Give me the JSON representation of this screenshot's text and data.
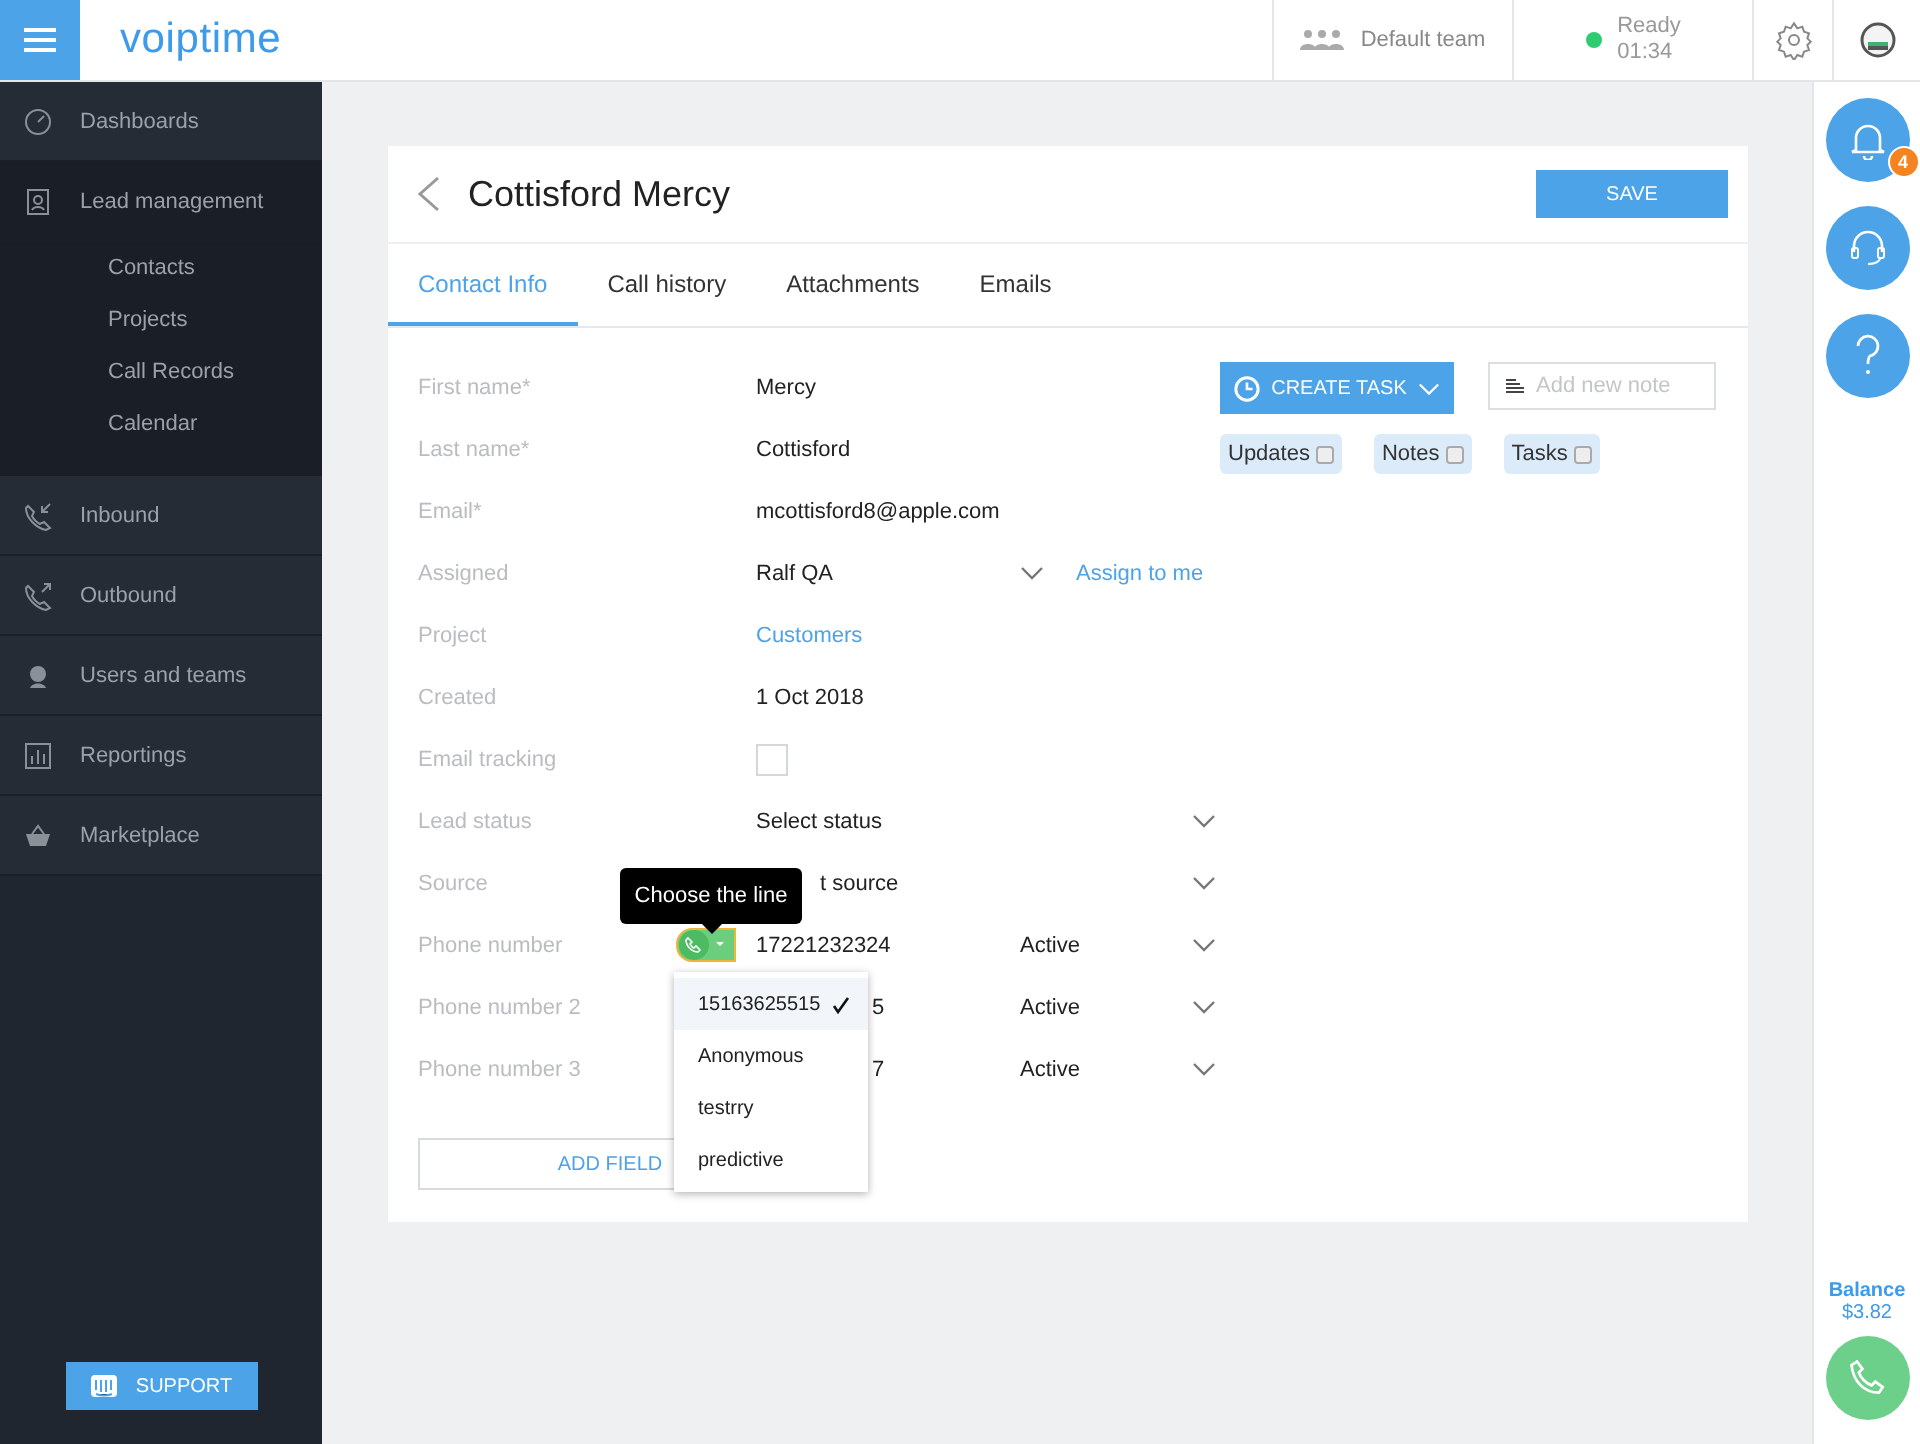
{
  "topbar": {
    "logo": "voiptime",
    "team": "Default team",
    "status": {
      "label": "Ready",
      "time": "01:34"
    }
  },
  "sidebar": {
    "items": [
      {
        "label": "Dashboards",
        "expanded": false
      },
      {
        "label": "Lead management",
        "expanded": true,
        "children": [
          {
            "label": "Contacts"
          },
          {
            "label": "Projects"
          },
          {
            "label": "Call Records"
          },
          {
            "label": "Calendar"
          }
        ]
      },
      {
        "label": "Inbound",
        "expanded": false
      },
      {
        "label": "Outbound",
        "expanded": false
      },
      {
        "label": "Users and teams",
        "expanded": false
      },
      {
        "label": "Reportings",
        "expanded": false
      },
      {
        "label": "Marketplace",
        "expanded": false
      }
    ],
    "support": "SUPPORT"
  },
  "contact": {
    "title": "Cottisford Mercy",
    "save": "SAVE",
    "tabs": [
      {
        "label": "Contact Info",
        "selected": true
      },
      {
        "label": "Call history",
        "selected": false
      },
      {
        "label": "Attachments",
        "selected": false
      },
      {
        "label": "Emails",
        "selected": false
      }
    ],
    "fields": [
      {
        "kind": "text",
        "label": "First name*",
        "value": "Mercy"
      },
      {
        "kind": "text",
        "label": "Last name*",
        "value": "Cottisford"
      },
      {
        "kind": "text",
        "label": "Email*",
        "value": "mcottisford8@apple.com"
      },
      {
        "kind": "assign",
        "label": "Assigned",
        "value": "Ralf QA",
        "action": "Assign to me"
      },
      {
        "kind": "link",
        "label": "Project",
        "value": "Customers"
      },
      {
        "kind": "text",
        "label": "Created",
        "value": "1 Oct 2018"
      },
      {
        "kind": "checkbox",
        "label": "Email tracking",
        "checked": false
      },
      {
        "kind": "select",
        "label": "Lead status",
        "value": "Select status"
      },
      {
        "kind": "select",
        "label": "Source",
        "value": "t source"
      },
      {
        "kind": "phone",
        "label": "Phone number",
        "value": "17221232324",
        "status": "Active",
        "line_button": true
      },
      {
        "kind": "phone",
        "label": "Phone number 2",
        "value": "5",
        "status": "Active"
      },
      {
        "kind": "phone",
        "label": "Phone number 3",
        "value": "7",
        "status": "Active"
      }
    ],
    "add_field": "ADD FIELD",
    "create_task": "CREATE TASK",
    "note": {
      "placeholder": "Add new note"
    },
    "filters": [
      {
        "label": "Updates",
        "checked": false
      },
      {
        "label": "Notes",
        "checked": false
      },
      {
        "label": "Tasks",
        "checked": false
      }
    ],
    "tooltip": "Choose the line",
    "lines": [
      {
        "label": "15163625515",
        "selected": true
      },
      {
        "label": "Anonymous",
        "selected": false
      },
      {
        "label": "testrry",
        "selected": false
      },
      {
        "label": "predictive",
        "selected": false
      }
    ]
  },
  "rail": {
    "badge": "4",
    "balance_label": "Balance",
    "balance": "$3.82"
  }
}
